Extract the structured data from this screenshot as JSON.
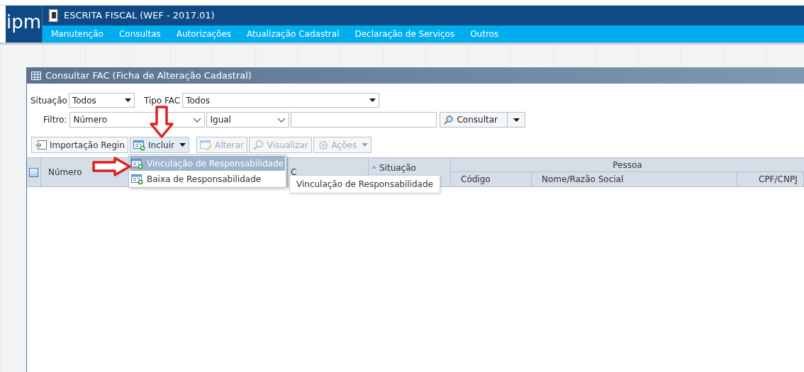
{
  "app": {
    "logo": "ipm",
    "title": "ESCRITA FISCAL (WEF - 2017.01)",
    "menu": [
      "Manutenção",
      "Consultas",
      "Autorizações",
      "Atualização Cadastral",
      "Declaração de Serviços",
      "Outros"
    ]
  },
  "window": {
    "title": "Consultar FAC (Ficha de Alteração Cadastral)",
    "filters": {
      "situacao_label": "Situação",
      "situacao_value": "Todos",
      "tipo_label": "Tipo FAC",
      "tipo_value": "Todos",
      "filtro_label": "Filtro:",
      "filtro_field": "Número",
      "filtro_operator": "Igual",
      "search_button": "Consultar"
    },
    "toolbar": [
      {
        "label": "Importação Regin",
        "kind": "import",
        "disabled": false,
        "dropdown": false,
        "open": false
      },
      {
        "label": "Incluir",
        "kind": "add",
        "disabled": false,
        "dropdown": true,
        "open": true
      },
      {
        "label": "Alterar",
        "kind": "edit",
        "disabled": true,
        "dropdown": false,
        "open": false
      },
      {
        "label": "Visualizar",
        "kind": "view",
        "disabled": true,
        "dropdown": false,
        "open": false
      },
      {
        "label": "Ações",
        "kind": "actions",
        "disabled": true,
        "dropdown": true,
        "open": false
      }
    ],
    "dropdown_menu": [
      {
        "label": "Vinculação de Responsabilidade",
        "selected": true
      },
      {
        "label": "Baixa de Responsabilidade",
        "selected": false
      }
    ],
    "tooltip": "Vinculação de Responsabilidade",
    "table": {
      "select_all_checked": false,
      "columns": [
        "Número",
        "C",
        "Situação"
      ],
      "group": "Pessoa",
      "group_columns": [
        "Código",
        "Nome/Razão Social",
        "CPF/CNPJ"
      ]
    }
  }
}
